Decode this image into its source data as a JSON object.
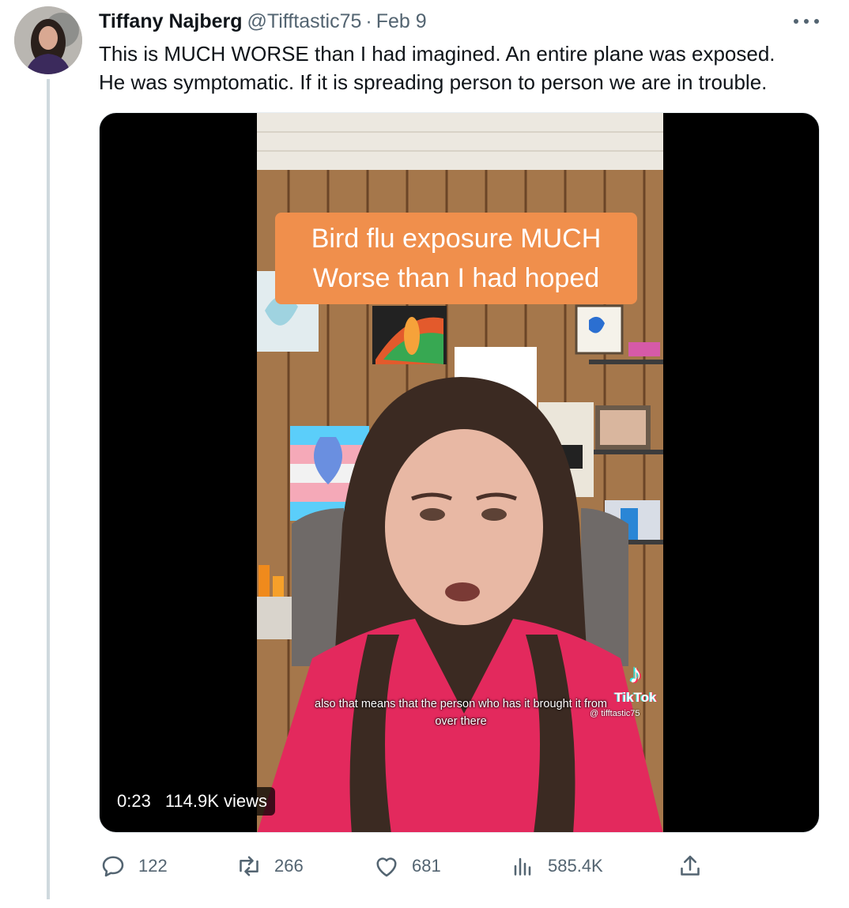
{
  "author": {
    "name": "Tiffany Najberg",
    "handle": "@Tifftastic75",
    "separator": "·",
    "date": "Feb 9"
  },
  "tweet": {
    "lines": [
      "This is MUCH WORSE than I had imagined. An entire plane was exposed.",
      "He was symptomatic. If it is spreading person to person we are in trouble."
    ]
  },
  "media": {
    "overlay_lines": [
      "Bird flu exposure MUCH",
      "Worse than I had hoped"
    ],
    "caption_lines": [
      "also that means that the person who has it brought it from",
      "over there"
    ],
    "tiktok_wordmark": "TikTok",
    "tiktok_user": "@ tifftastic75",
    "duration": "0:23",
    "views": "114.9K views",
    "overlay_color": "#f08f4c"
  },
  "actions": {
    "replies": "122",
    "retweets": "266",
    "likes": "681",
    "views": "585.4K"
  },
  "icons": {
    "more": "more-horizontal-icon",
    "reply": "reply-icon",
    "retweet": "retweet-icon",
    "like": "heart-icon",
    "analytics": "bar-chart-icon",
    "share": "share-icon",
    "tiktok": "tiktok-note-icon"
  }
}
